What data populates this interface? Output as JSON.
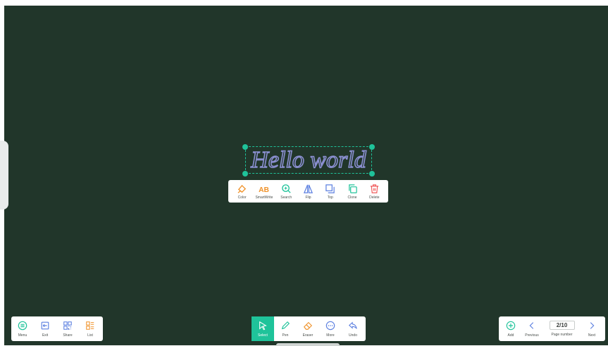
{
  "canvas": {
    "text": "Hello world",
    "colors": {
      "board": "#21362a",
      "accent": "#1fc39a",
      "text_stroke": "#8a8fd0"
    }
  },
  "context_toolbar": {
    "items": [
      {
        "label": "Color",
        "icon": "color-icon",
        "color": "#f0932b"
      },
      {
        "label": "SmartWrite",
        "icon": "smartwrite-icon",
        "color": "#f0932b"
      },
      {
        "label": "Search",
        "icon": "search-icon",
        "color": "#1fc39a"
      },
      {
        "label": "Flip",
        "icon": "flip-icon",
        "color": "#5b7fe0"
      },
      {
        "label": "Top",
        "icon": "top-icon",
        "color": "#5b7fe0"
      },
      {
        "label": "Clone",
        "icon": "clone-icon",
        "color": "#1fc39a"
      },
      {
        "label": "Delete",
        "icon": "delete-icon",
        "color": "#f05a5a"
      }
    ]
  },
  "left_toolbar": {
    "items": [
      {
        "label": "Menu",
        "icon": "menu-icon"
      },
      {
        "label": "Exit",
        "icon": "exit-icon"
      },
      {
        "label": "Share",
        "icon": "share-icon"
      },
      {
        "label": "List",
        "icon": "list-icon"
      }
    ]
  },
  "center_toolbar": {
    "items": [
      {
        "label": "Select",
        "icon": "select-icon",
        "active": true
      },
      {
        "label": "Pen",
        "icon": "pen-icon"
      },
      {
        "label": "Eraser",
        "icon": "eraser-icon"
      },
      {
        "label": "More",
        "icon": "more-icon"
      },
      {
        "label": "Undo",
        "icon": "undo-icon"
      }
    ]
  },
  "right_toolbar": {
    "add_label": "Add",
    "previous_label": "Previous",
    "page_number": "2/10",
    "page_number_label": "Page number",
    "next_label": "Next"
  }
}
